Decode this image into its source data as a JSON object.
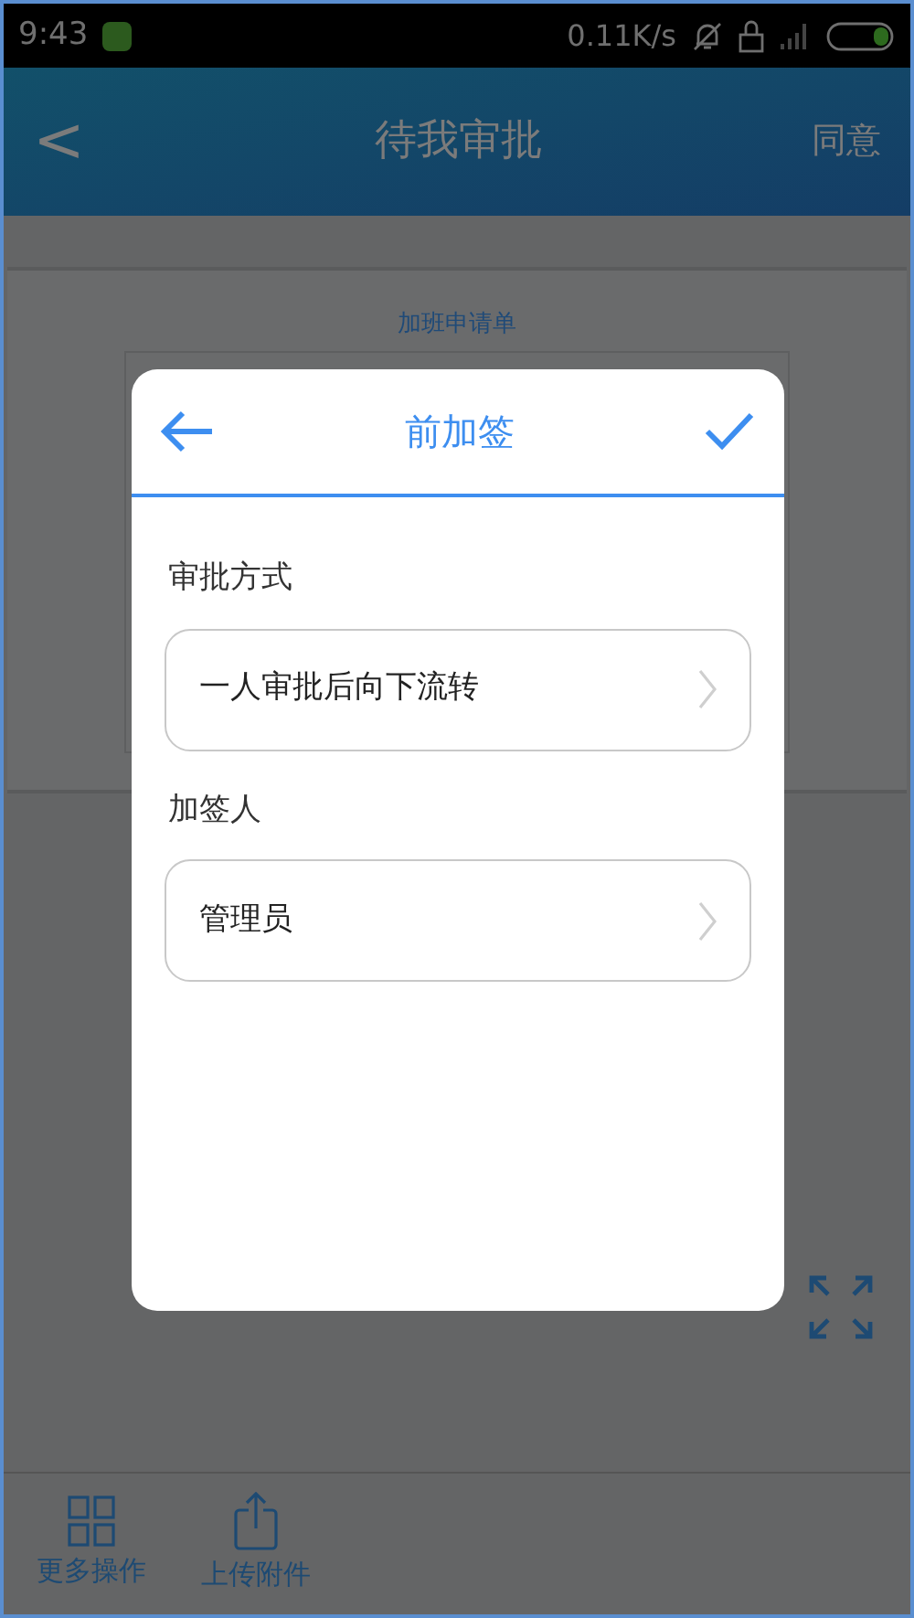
{
  "status_bar": {
    "time": "9:43",
    "speed": "0.11K/s"
  },
  "header": {
    "back": "<",
    "title": "待我审批",
    "action": "同意"
  },
  "form": {
    "title": "加班申请单"
  },
  "dialog": {
    "title": "前加签",
    "fields": [
      {
        "label": "审批方式",
        "value": "一人审批后向下流转"
      },
      {
        "label": "加签人",
        "value": "管理员"
      }
    ]
  },
  "toolbar": [
    {
      "kind": "grid",
      "label": "更多操作"
    },
    {
      "kind": "upload",
      "label": "上传附件"
    }
  ]
}
